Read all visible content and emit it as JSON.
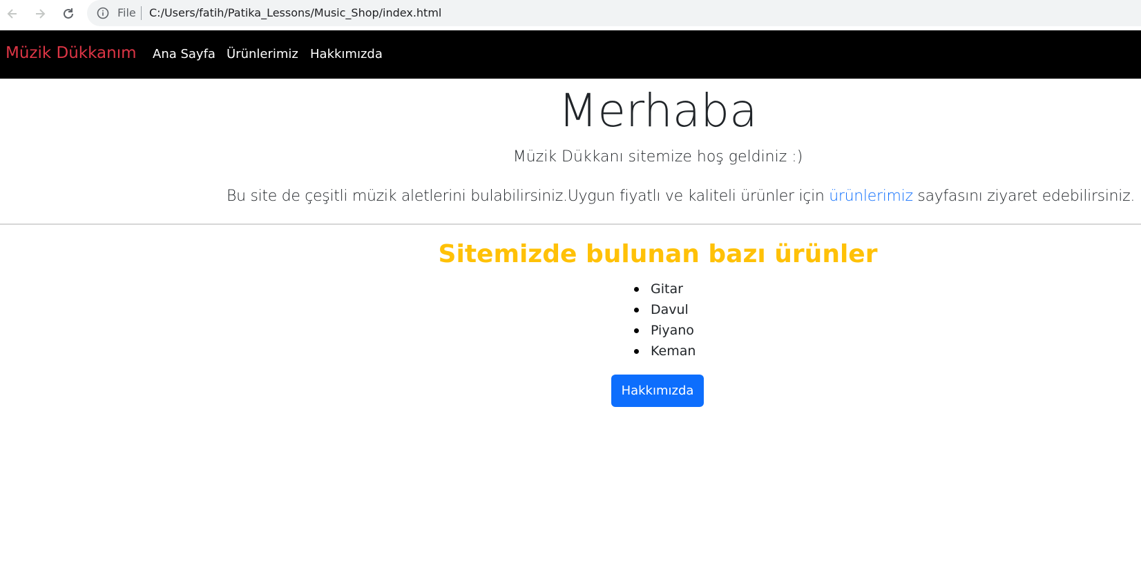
{
  "browser": {
    "file_label": "File",
    "url": "C:/Users/fatih/Patika_Lessons/Music_Shop/index.html"
  },
  "navbar": {
    "brand": "Müzik Dükkanım",
    "links": [
      "Ana Sayfa",
      "Ürünlerimiz",
      "Hakkımızda"
    ],
    "colors": {
      "background": "#000000",
      "brand": "#dc3545",
      "link": "#ffffff"
    }
  },
  "hero": {
    "title": "Merhaba",
    "welcome": "Müzik Dükkanı sitemize hoş geldiniz :)",
    "description_before": "Bu site de çeşitli müzik aletlerini bulabilirsiniz.Uygun fiyatlı ve kaliteli ürünler için ",
    "description_link": "ürünlerimiz",
    "description_after": " sayfasını ziyaret edebilirsiniz.",
    "link_color": "#0d6efd"
  },
  "products": {
    "heading": "Sitemizde bulunan bazı ürünler",
    "heading_color": "#ffc107",
    "items": [
      "Gitar",
      "Davul",
      "Piyano",
      "Keman"
    ]
  },
  "about_button": {
    "label": "Hakkımızda",
    "color": "#0d6efd"
  },
  "icons": [
    "back-arrow-icon",
    "forward-arrow-icon",
    "reload-icon",
    "info-icon"
  ]
}
